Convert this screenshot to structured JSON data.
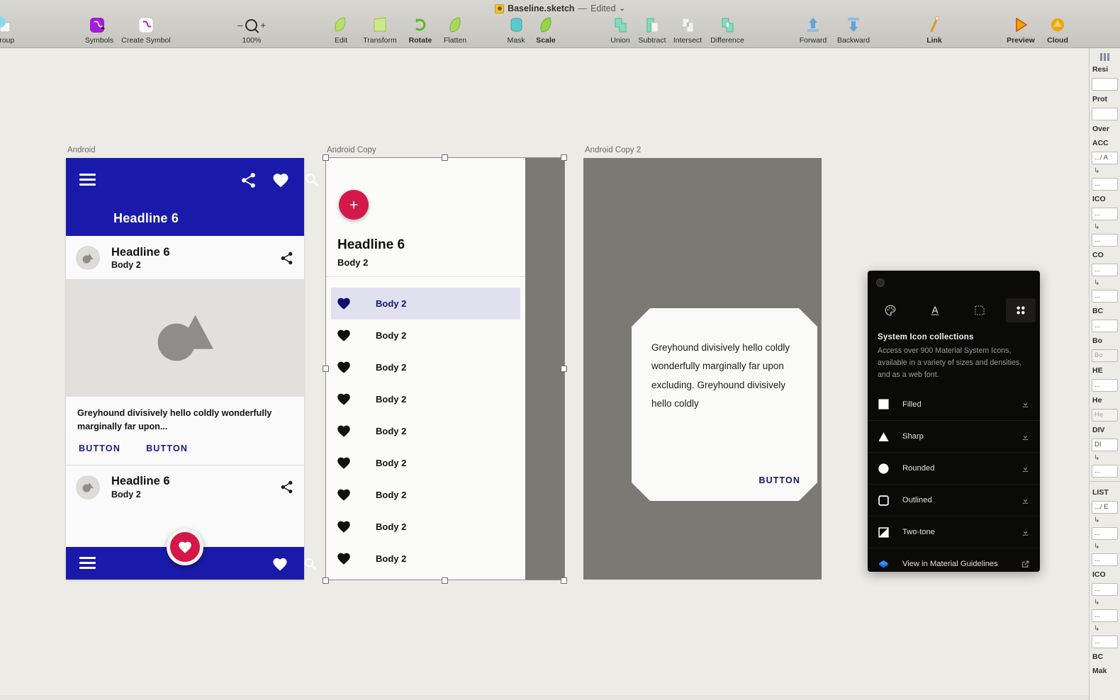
{
  "window": {
    "title": "Baseline.sketch",
    "separator": "—",
    "edited": "Edited",
    "caret": "⌄",
    "doc_icon": "sketch-document-icon"
  },
  "toolbar": {
    "groups": [
      {
        "items": [
          {
            "label": "ngroup",
            "icon": "ungroup-icon",
            "bold": false
          }
        ]
      },
      {
        "items": [
          {
            "label": "Symbols",
            "icon": "symbols-icon",
            "bold": false
          },
          {
            "label": "Create Symbol",
            "icon": "create-symbol-icon",
            "bold": false
          }
        ]
      },
      {
        "items": [
          {
            "label": "Edit",
            "icon": "edit-icon",
            "bold": false
          },
          {
            "label": "Transform",
            "icon": "transform-icon",
            "bold": false
          },
          {
            "label": "Rotate",
            "icon": "rotate-icon",
            "bold": true
          },
          {
            "label": "Flatten",
            "icon": "flatten-icon",
            "bold": false
          }
        ]
      },
      {
        "items": [
          {
            "label": "Mask",
            "icon": "mask-icon",
            "bold": false
          },
          {
            "label": "Scale",
            "icon": "scale-icon",
            "bold": true
          }
        ]
      },
      {
        "items": [
          {
            "label": "Union",
            "icon": "union-icon",
            "bold": false
          },
          {
            "label": "Subtract",
            "icon": "subtract-icon",
            "bold": false
          },
          {
            "label": "Intersect",
            "icon": "intersect-icon",
            "bold": false
          },
          {
            "label": "Difference",
            "icon": "difference-icon",
            "bold": false
          }
        ]
      },
      {
        "items": [
          {
            "label": "Forward",
            "icon": "forward-icon",
            "bold": false
          },
          {
            "label": "Backward",
            "icon": "backward-icon",
            "bold": false
          }
        ]
      },
      {
        "items": [
          {
            "label": "Link",
            "icon": "link-icon",
            "bold": true
          }
        ]
      },
      {
        "items": [
          {
            "label": "Preview",
            "icon": "preview-icon",
            "bold": true
          },
          {
            "label": "Cloud",
            "icon": "cloud-icon",
            "bold": true
          }
        ]
      }
    ],
    "zoom": {
      "level": "100%",
      "minus": "–",
      "plus": "+",
      "icon": "magnifier-icon"
    }
  },
  "canvas": {
    "artboards": [
      {
        "name": "Android"
      },
      {
        "name": "Android Copy"
      },
      {
        "name": "Android Copy 2"
      }
    ]
  },
  "artboard1": {
    "label": "Android",
    "appbar": {
      "headline": "Headline 6",
      "menu_icon": "hamburger-menu-icon",
      "share_icon": "share-icon",
      "favorite_icon": "heart-icon",
      "search_icon": "search-icon"
    },
    "card_header": {
      "headline": "Headline 6",
      "body": "Body 2",
      "avatar_icon": "image-placeholder-avatar-icon",
      "share_icon": "share-icon"
    },
    "media_icon": "image-placeholder-icon",
    "supporting_text": "Greyhound divisively hello coldly wonderfully marginally far upon...",
    "buttons": [
      "BUTTON",
      "BUTTON"
    ],
    "card_header2": {
      "headline": "Headline 6",
      "body": "Body 2",
      "avatar_icon": "image-placeholder-avatar-icon",
      "share_icon": "share-icon"
    },
    "bottombar": {
      "menu_icon": "hamburger-menu-icon",
      "favorite_icon": "heart-icon",
      "search_icon": "search-icon",
      "fab_icon": "heart-icon"
    }
  },
  "artboard2": {
    "label": "Android Copy",
    "fab_icon": "plus-icon",
    "headline": "Headline 6",
    "body": "Body 2",
    "items": [
      {
        "label": "Body 2",
        "icon": "heart-icon",
        "selected": true
      },
      {
        "label": "Body 2",
        "icon": "heart-icon",
        "selected": false
      },
      {
        "label": "Body 2",
        "icon": "heart-icon",
        "selected": false
      },
      {
        "label": "Body 2",
        "icon": "heart-icon",
        "selected": false
      },
      {
        "label": "Body 2",
        "icon": "heart-icon",
        "selected": false
      },
      {
        "label": "Body 2",
        "icon": "heart-icon",
        "selected": false
      },
      {
        "label": "Body 2",
        "icon": "heart-icon",
        "selected": false
      },
      {
        "label": "Body 2",
        "icon": "heart-icon",
        "selected": false
      },
      {
        "label": "Body 2",
        "icon": "heart-icon",
        "selected": false
      }
    ]
  },
  "artboard3": {
    "label": "Android Copy 2",
    "card_text": "Greyhound divisively hello coldly wonderfully marginally far upon excluding. Greyhound divisively hello coldly",
    "card_button": "BUTTON"
  },
  "panel": {
    "logo_icon": "material-logo-icon",
    "tabs": [
      {
        "icon": "palette-icon",
        "active": false
      },
      {
        "icon": "typography-icon",
        "active": false
      },
      {
        "icon": "shape-icon",
        "active": false
      },
      {
        "icon": "grid-icon",
        "active": true
      }
    ],
    "title": "System Icon collections",
    "description": "Access over 900 Material System Icons, available in a variety of sizes and densities, and as a web font.",
    "rows": [
      {
        "label": "Filled",
        "icon": "filled-square-icon",
        "action_icon": "download-icon"
      },
      {
        "label": "Sharp",
        "icon": "sharp-triangle-icon",
        "action_icon": "download-icon"
      },
      {
        "label": "Rounded",
        "icon": "rounded-circle-icon",
        "action_icon": "download-icon"
      },
      {
        "label": "Outlined",
        "icon": "outlined-square-icon",
        "action_icon": "download-icon"
      },
      {
        "label": "Two-tone",
        "icon": "two-tone-icon",
        "action_icon": "download-icon"
      },
      {
        "label": "View in Material Guidelines",
        "icon": "material-guidelines-icon",
        "action_icon": "external-link-icon"
      }
    ]
  },
  "sidebar": {
    "grid_icon": "alignment-icon",
    "sections": [
      {
        "type": "head",
        "text": "Resi"
      },
      {
        "type": "field",
        "text": ""
      },
      {
        "type": "head",
        "text": "Prot"
      },
      {
        "type": "field",
        "text": ""
      },
      {
        "type": "head",
        "text": "Over"
      },
      {
        "type": "head",
        "text": "ACC"
      },
      {
        "type": "field",
        "text": ".../ A"
      },
      {
        "type": "sub",
        "text": "↳"
      },
      {
        "type": "field",
        "text": "..."
      },
      {
        "type": "head",
        "text": "ICO"
      },
      {
        "type": "field",
        "text": "..."
      },
      {
        "type": "sub",
        "text": "↳"
      },
      {
        "type": "field",
        "text": "..."
      },
      {
        "type": "head",
        "text": "CO"
      },
      {
        "type": "field",
        "text": "..."
      },
      {
        "type": "sub",
        "text": "↳"
      },
      {
        "type": "field",
        "text": "..."
      },
      {
        "type": "head",
        "text": "BC"
      },
      {
        "type": "field",
        "text": "..."
      },
      {
        "type": "head",
        "text": "Bo"
      },
      {
        "type": "ghost",
        "text": "Bo"
      },
      {
        "type": "head",
        "text": "HE"
      },
      {
        "type": "field",
        "text": "..."
      },
      {
        "type": "head",
        "text": "He"
      },
      {
        "type": "ghost",
        "text": "He"
      },
      {
        "type": "head",
        "text": "DIV"
      },
      {
        "type": "field",
        "text": "DI"
      },
      {
        "type": "sub",
        "text": "↳"
      },
      {
        "type": "field",
        "text": "..."
      },
      {
        "type": "div",
        "text": ""
      },
      {
        "type": "head",
        "text": "LIST"
      },
      {
        "type": "field",
        "text": ".../ E"
      },
      {
        "type": "sub",
        "text": "↳"
      },
      {
        "type": "field",
        "text": "..."
      },
      {
        "type": "sub",
        "text": "↳"
      },
      {
        "type": "field",
        "text": "..."
      },
      {
        "type": "head",
        "text": "ICO"
      },
      {
        "type": "field",
        "text": "..."
      },
      {
        "type": "sub",
        "text": "↳"
      },
      {
        "type": "field",
        "text": "..."
      },
      {
        "type": "sub",
        "text": "↳"
      },
      {
        "type": "field",
        "text": "..."
      },
      {
        "type": "head",
        "text": "BC"
      },
      {
        "type": "head",
        "text": "Mak"
      }
    ]
  },
  "colors": {
    "appbar_blue": "#1A1AAA",
    "fab_crimson": "#D4184A",
    "canvas_bg": "#edebe6",
    "artboard3_bg": "#7b7974",
    "panel_bg": "#0a0a09",
    "selected_row": "#e0e0ef"
  }
}
